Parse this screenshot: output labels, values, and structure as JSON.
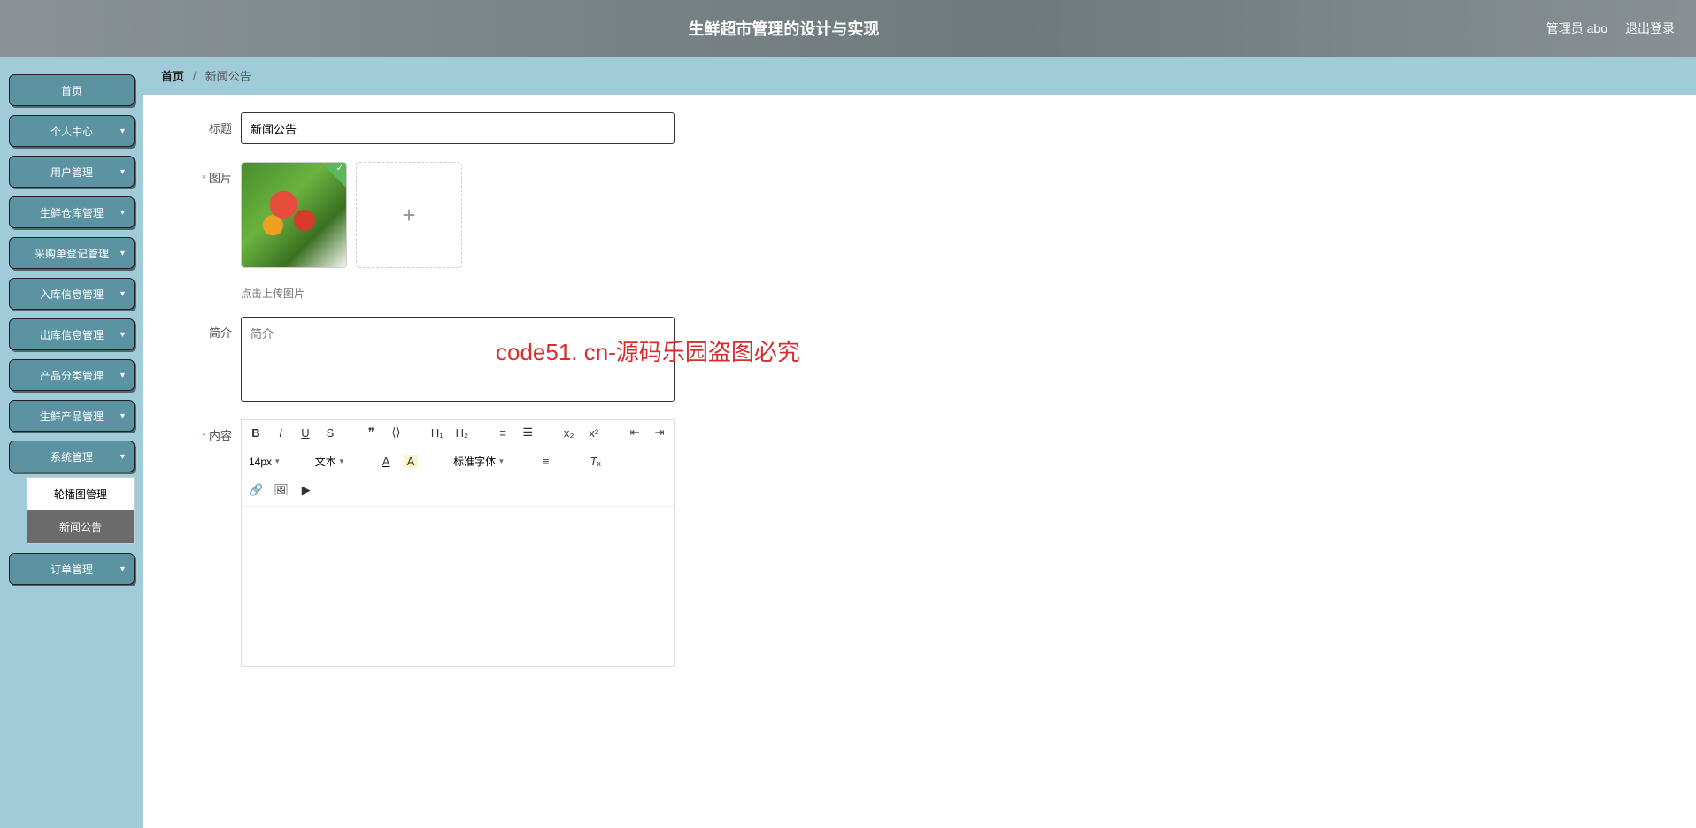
{
  "watermark": "code51.cn",
  "watermark_red": "code51. cn-源码乐园盗图必究",
  "header": {
    "title": "生鲜超市管理的设计与实现",
    "user_label": "管理员 abo",
    "logout": "退出登录"
  },
  "sidebar": {
    "items": [
      {
        "label": "首页",
        "expandable": false
      },
      {
        "label": "个人中心",
        "expandable": true
      },
      {
        "label": "用户管理",
        "expandable": true
      },
      {
        "label": "生鲜仓库管理",
        "expandable": true
      },
      {
        "label": "采购单登记管理",
        "expandable": true
      },
      {
        "label": "入库信息管理",
        "expandable": true
      },
      {
        "label": "出库信息管理",
        "expandable": true
      },
      {
        "label": "产品分类管理",
        "expandable": true
      },
      {
        "label": "生鲜产品管理",
        "expandable": true
      },
      {
        "label": "系统管理",
        "expandable": true,
        "expanded": true,
        "children": [
          {
            "label": "轮播图管理",
            "active": false
          },
          {
            "label": "新闻公告",
            "active": true
          }
        ]
      },
      {
        "label": "订单管理",
        "expandable": true
      }
    ]
  },
  "breadcrumb": {
    "home": "首页",
    "current": "新闻公告"
  },
  "form": {
    "title_label": "标题",
    "title_value": "新闻公告",
    "image_label": "图片",
    "upload_hint": "点击上传图片",
    "intro_label": "简介",
    "intro_placeholder": "简介",
    "content_label": "内容"
  },
  "editor": {
    "font_size": "14px",
    "block_type": "文本",
    "font_family": "标准字体"
  }
}
